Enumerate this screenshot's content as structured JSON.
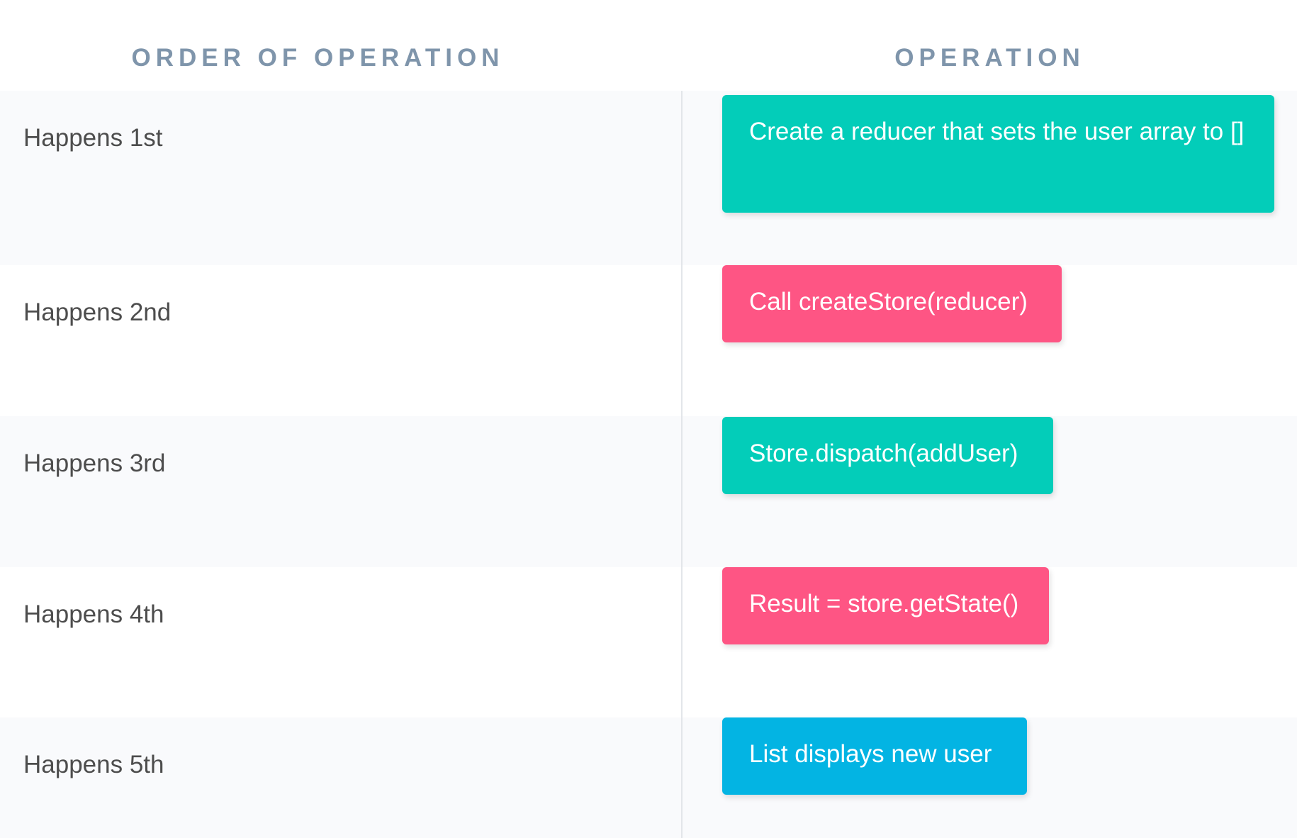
{
  "header": {
    "order_label": "ORDER OF OPERATION",
    "operation_label": "OPERATION"
  },
  "rows": [
    {
      "order": "Happens 1st",
      "operation": "Create a reducer that sets the user array to []",
      "color": "#03cdb9"
    },
    {
      "order": "Happens 2nd",
      "operation": "Call createStore(reducer)",
      "color": "#fe5584"
    },
    {
      "order": "Happens 3rd",
      "operation": "Store.dispatch(addUser)",
      "color": "#03cdb9"
    },
    {
      "order": "Happens 4th",
      "operation": "Result = store.getState()",
      "color": "#fe5584"
    },
    {
      "order": "Happens 5th",
      "operation": "List displays new user",
      "color": "#03b4e3"
    }
  ]
}
